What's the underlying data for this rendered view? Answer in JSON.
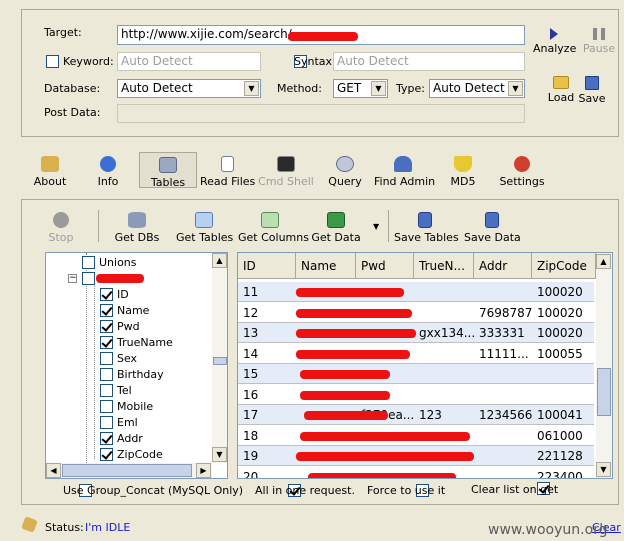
{
  "config": {
    "target_label": "Target:",
    "target_value": "http://www.xijie.com/search/",
    "keyword_label": "Keyword:",
    "keyword_placeholder": "Auto Detect",
    "syntax_label": "Syntax:",
    "syntax_placeholder": "Auto Detect",
    "database_label": "Database:",
    "database_value": "Auto Detect",
    "method_label": "Method:",
    "method_value": "GET",
    "type_label": "Type:",
    "type_value": "Auto Detect",
    "postdata_label": "Post Data:",
    "analyze_label": "Analyze",
    "pause_label": "Pause",
    "load_label": "Load",
    "save_label": "Save"
  },
  "main_toolbar": [
    {
      "label": "About",
      "icon": "about-icon"
    },
    {
      "label": "Info",
      "icon": "info-icon"
    },
    {
      "label": "Tables",
      "icon": "tables-icon"
    },
    {
      "label": "Read Files",
      "icon": "read-files-icon"
    },
    {
      "label": "Cmd Shell",
      "icon": "cmd-shell-icon"
    },
    {
      "label": "Query",
      "icon": "query-icon"
    },
    {
      "label": "Find Admin",
      "icon": "find-admin-icon"
    },
    {
      "label": "MD5",
      "icon": "md5-icon"
    },
    {
      "label": "Settings",
      "icon": "settings-icon"
    }
  ],
  "tables_toolbar": {
    "stop": "Stop",
    "get_dbs": "Get DBs",
    "get_tables": "Get Tables",
    "get_columns": "Get Columns",
    "get_data": "Get Data",
    "save_tables": "Save Tables",
    "save_data": "Save Data"
  },
  "tree": {
    "items": [
      {
        "label": "Unions",
        "checked": false
      },
      {
        "label": "",
        "checked": false
      },
      {
        "label": "ID",
        "checked": true
      },
      {
        "label": "Name",
        "checked": true
      },
      {
        "label": "Pwd",
        "checked": true
      },
      {
        "label": "TrueName",
        "checked": true
      },
      {
        "label": "Sex",
        "checked": false
      },
      {
        "label": "Birthday",
        "checked": false
      },
      {
        "label": "Tel",
        "checked": false
      },
      {
        "label": "Mobile",
        "checked": false
      },
      {
        "label": "Eml",
        "checked": false
      },
      {
        "label": "Addr",
        "checked": true
      },
      {
        "label": "ZipCode",
        "checked": true
      }
    ]
  },
  "grid": {
    "columns": [
      "ID",
      "Name",
      "Pwd",
      "TrueN...",
      "Addr",
      "ZipCode"
    ],
    "rows": [
      [
        "11",
        "",
        "",
        "",
        "",
        "100020"
      ],
      [
        "12",
        "",
        "",
        "",
        "7698787",
        "100020"
      ],
      [
        "13",
        "",
        "",
        "gxx134...",
        "333331",
        "100020"
      ],
      [
        "14",
        "",
        "",
        "",
        "11111...",
        "100055"
      ],
      [
        "15",
        "",
        "",
        "",
        "",
        ""
      ],
      [
        "16",
        "",
        "",
        "",
        "",
        ""
      ],
      [
        "17",
        "",
        "f379ea...",
        "123",
        "1234566",
        "100041"
      ],
      [
        "18",
        "",
        "",
        "",
        "",
        "061000"
      ],
      [
        "19",
        "",
        "",
        "",
        "",
        "221128"
      ],
      [
        "20",
        "",
        "",
        "",
        "",
        "223400"
      ]
    ]
  },
  "options": {
    "group_concat": "Use Group_Concat (MySQL Only)",
    "all_in_one": "All in one request.",
    "force": "Force to use it",
    "clear_list": "Clear list on get"
  },
  "status": {
    "label": "Status:",
    "value": "I'm IDLE",
    "clear": "Clear"
  },
  "watermark": "www.wooyun.org",
  "colors": {
    "redaction": "#ee1111",
    "status_value": "#1a1ad0"
  }
}
